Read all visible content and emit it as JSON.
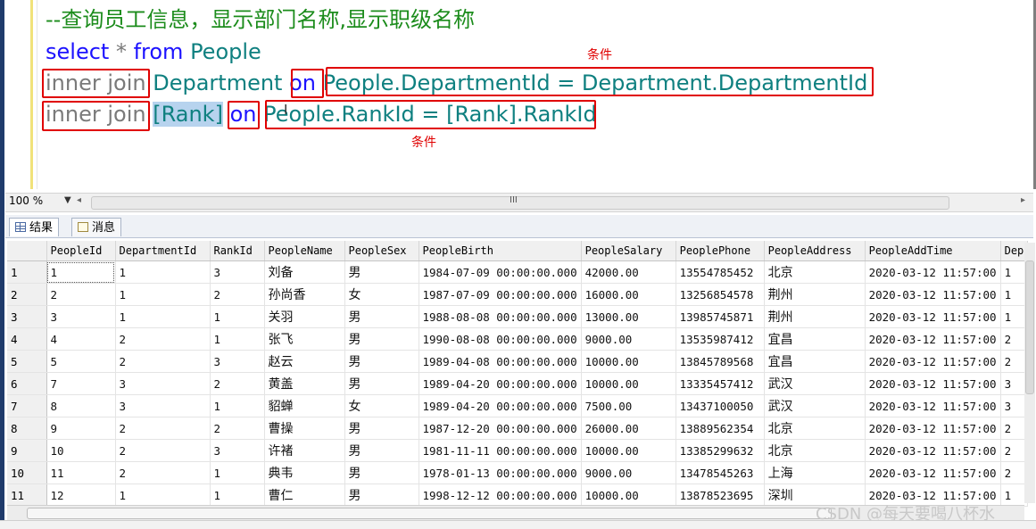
{
  "editor": {
    "comment": "--查询员工信息，显示部门名称,显示职级名称",
    "line_select": [
      "select",
      " * ",
      "from",
      " People"
    ],
    "line_join1": {
      "kw": "inner join",
      "table": "Department",
      "on": "on",
      "cond": "People.DepartmentId = Department.DepartmentId"
    },
    "line_join2": {
      "kw": "inner join",
      "table": "[Rank]",
      "on": "on",
      "cond": "People.RankId = [Rank].RankId"
    },
    "annotation_top": "条件",
    "annotation_bottom": "条件"
  },
  "zoom": "100 %",
  "tabs": [
    {
      "label": "结果"
    },
    {
      "label": "消息"
    }
  ],
  "grid": {
    "columns": [
      "PeopleId",
      "DepartmentId",
      "RankId",
      "PeopleName",
      "PeopleSex",
      "PeopleBirth",
      "PeopleSalary",
      "PeoplePhone",
      "PeopleAddress",
      "PeopleAddTime",
      "Dep"
    ],
    "rows": [
      [
        "1",
        "1",
        "1",
        "3",
        "刘备",
        "男",
        "1984-07-09 00:00:00.000",
        "42000.00",
        "13554785452",
        "北京",
        "2020-03-12 11:57:00",
        "1"
      ],
      [
        "2",
        "2",
        "1",
        "2",
        "孙尚香",
        "女",
        "1987-07-09 00:00:00.000",
        "16000.00",
        "13256854578",
        "荆州",
        "2020-03-12 11:57:00",
        "1"
      ],
      [
        "3",
        "3",
        "1",
        "1",
        "关羽",
        "男",
        "1988-08-08 00:00:00.000",
        "13000.00",
        "13985745871",
        "荆州",
        "2020-03-12 11:57:00",
        "1"
      ],
      [
        "4",
        "4",
        "2",
        "1",
        "张飞",
        "男",
        "1990-08-08 00:00:00.000",
        "9000.00",
        "13535987412",
        "宜昌",
        "2020-03-12 11:57:00",
        "2"
      ],
      [
        "5",
        "5",
        "2",
        "3",
        "赵云",
        "男",
        "1989-04-08 00:00:00.000",
        "10000.00",
        "13845789568",
        "宜昌",
        "2020-03-12 11:57:00",
        "2"
      ],
      [
        "6",
        "7",
        "3",
        "2",
        "黄盖",
        "男",
        "1989-04-20 00:00:00.000",
        "10000.00",
        "13335457412",
        "武汉",
        "2020-03-12 11:57:00",
        "3"
      ],
      [
        "7",
        "8",
        "3",
        "1",
        "貂蝉",
        "女",
        "1989-04-20 00:00:00.000",
        "7500.00",
        "13437100050",
        "武汉",
        "2020-03-12 11:57:00",
        "3"
      ],
      [
        "8",
        "9",
        "2",
        "2",
        "曹操",
        "男",
        "1987-12-20 00:00:00.000",
        "26000.00",
        "13889562354",
        "北京",
        "2020-03-12 11:57:00",
        "2"
      ],
      [
        "9",
        "10",
        "2",
        "3",
        "许褚",
        "男",
        "1981-11-11 00:00:00.000",
        "10000.00",
        "13385299632",
        "北京",
        "2020-03-12 11:57:00",
        "2"
      ],
      [
        "10",
        "11",
        "2",
        "1",
        "典韦",
        "男",
        "1978-01-13 00:00:00.000",
        "9000.00",
        "13478545263",
        "上海",
        "2020-03-12 11:57:00",
        "2"
      ],
      [
        "11",
        "12",
        "1",
        "1",
        "曹仁",
        "男",
        "1998-12-12 00:00:00.000",
        "10000.00",
        "13878523695",
        "深圳",
        "2020-03-12 11:57:00",
        "1"
      ]
    ]
  },
  "watermark": "CSDN @每天要喝八杯水",
  "colors": {
    "keyword": "#1c12ff",
    "identifier": "#0f8080",
    "comment": "#1c8c1c",
    "annotation_red": "#e00000"
  }
}
